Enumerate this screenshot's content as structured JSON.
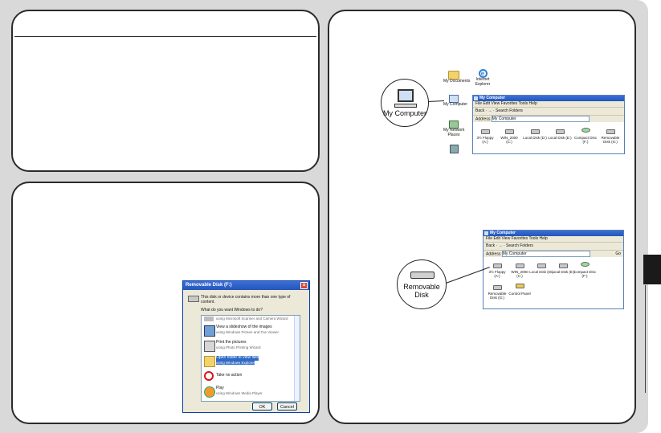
{
  "desktop": {
    "icons": [
      {
        "name": "My Documents"
      },
      {
        "name": "Internet\nExplorer"
      },
      {
        "name": "My Computer"
      },
      {
        "name": "My Network\nPlaces"
      }
    ]
  },
  "callout_top": "My Computer",
  "callout_bottom": "Removable\nDisk",
  "window1": {
    "title": "My Computer",
    "menu": "File   Edit   View   Favorites   Tools   Help",
    "toolbar": "Back  ·  →  ·  Search   Folders",
    "address_label": "Address",
    "address_value": "My Computer",
    "drives": [
      "3½ Floppy\n(A:)",
      "WIN_2000\n(C:)",
      "Local Disk (D:)",
      "Local Disk (E:)",
      "Compact Disc\n(F:)",
      "Removable\nDisk (G:)"
    ]
  },
  "window2": {
    "title": "My Computer",
    "menu": "File   Edit   View   Favorites   Tools   Help",
    "toolbar": "Back  ·  →  ·  Search   Folders",
    "address_label": "Address",
    "address_value": "My Computer",
    "go": "Go",
    "drives": [
      "3½ Floppy\n(A:)",
      "WIN_2000\n(C:)",
      "Local Disk (D:)",
      "Local Disk (E:)",
      "Compact Disc\n(F:)",
      "Removable\nDisk (G:)",
      "Control Panel"
    ]
  },
  "dialog": {
    "title": "Removable Disk (F:)",
    "message": "This disk or device contains more than one type of content.",
    "question": "What do you want Windows to do?",
    "options": [
      {
        "title": "",
        "subtitle": "using Microsoft Scanner and Camera Wizard"
      },
      {
        "title": "View a slideshow of the images",
        "subtitle": "using Windows Picture and Fax Viewer"
      },
      {
        "title": "Print the pictures",
        "subtitle": "using Photo Printing Wizard"
      },
      {
        "title": "Open folder to view files",
        "subtitle": "using Windows Explorer"
      },
      {
        "title": "Take no action",
        "subtitle": ""
      },
      {
        "title": "Play",
        "subtitle": "using Windows Media Player"
      }
    ],
    "ok": "OK",
    "cancel": "Cancel"
  }
}
